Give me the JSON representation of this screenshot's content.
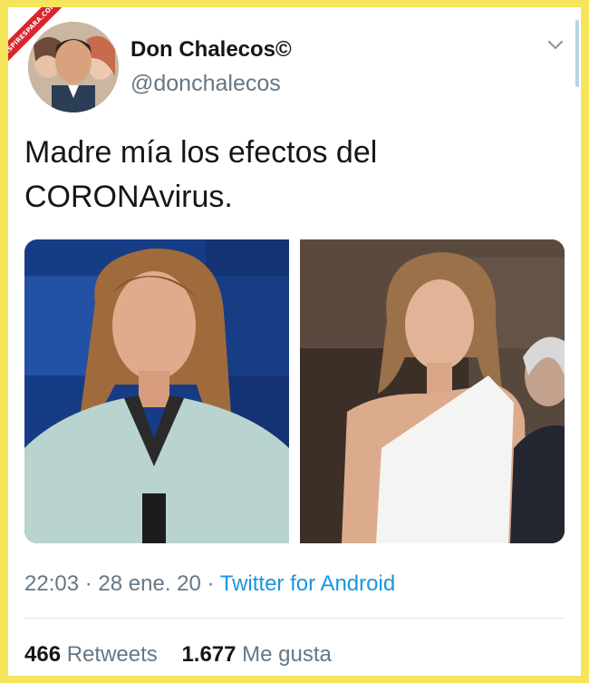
{
  "badge": {
    "text": "ASPIRESPARA.COM"
  },
  "tweet": {
    "display_name": "Don Chalecos©",
    "handle": "@donchalecos",
    "text": "Madre mía los efectos del CORONAvirus.",
    "time": "22:03",
    "separator": "·",
    "date": "28 ene. 20",
    "source": "Twitter for Android",
    "retweets_count": "466",
    "retweets_label": "Retweets",
    "likes_count": "1.677",
    "likes_label": "Me gusta"
  },
  "icons": {
    "menu": "chevron-down-icon"
  },
  "colors": {
    "frame": "#f6e45a",
    "link": "#1b95e0",
    "muted": "#657786",
    "text": "#14171a"
  }
}
